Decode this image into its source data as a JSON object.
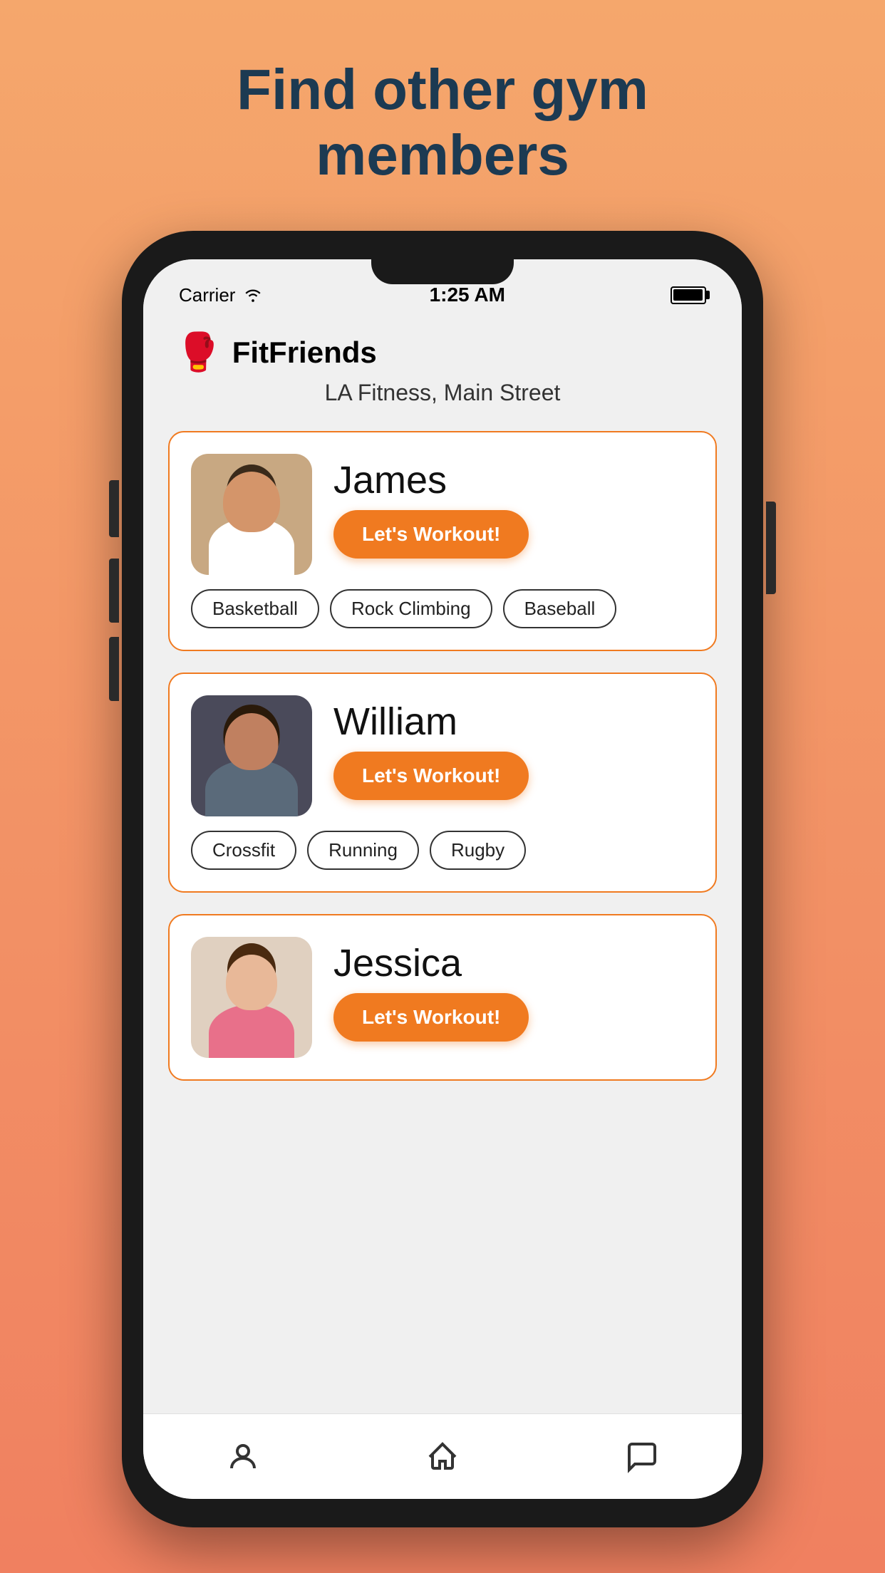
{
  "page": {
    "headline": "Find other gym\nmembers",
    "background_gradient_start": "#F5A76C",
    "background_gradient_end": "#F08060"
  },
  "status_bar": {
    "carrier": "Carrier",
    "time": "1:25 AM",
    "battery": "full"
  },
  "app": {
    "name": "FitFriends",
    "logo": "🥊",
    "gym": "LA Fitness, Main Street"
  },
  "members": [
    {
      "name": "James",
      "workout_btn": "Let's Workout!",
      "tags": [
        "Basketball",
        "Rock Climbing",
        "Baseball"
      ],
      "avatar_type": "james"
    },
    {
      "name": "William",
      "workout_btn": "Let's Workout!",
      "tags": [
        "Crossfit",
        "Running",
        "Rugby"
      ],
      "avatar_type": "william"
    },
    {
      "name": "Jessica",
      "workout_btn": "Let's Workout!",
      "tags": [],
      "avatar_type": "jessica"
    }
  ],
  "nav": {
    "items": [
      {
        "icon": "person",
        "label": "Profile"
      },
      {
        "icon": "home",
        "label": "Home"
      },
      {
        "icon": "chat",
        "label": "Messages"
      }
    ]
  }
}
